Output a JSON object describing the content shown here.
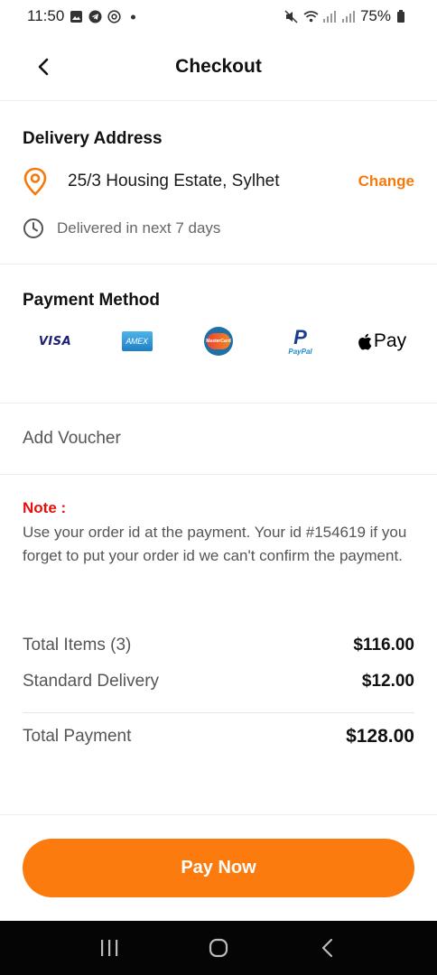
{
  "status_bar": {
    "time": "11:50",
    "battery": "75%",
    "left_icons": [
      "gallery-icon",
      "telegram-icon",
      "at-icon",
      "dot-icon"
    ],
    "right_icons": [
      "mute-icon",
      "wifi-icon",
      "signal-icon",
      "signal-icon",
      "battery-icon"
    ]
  },
  "header": {
    "title": "Checkout",
    "back_icon": "chevron-left-icon"
  },
  "delivery": {
    "title": "Delivery Address",
    "address": "25/3 Housing Estate, Sylhet",
    "change_label": "Change",
    "eta": "Delivered in next 7 days",
    "accent_color": "#f57a0c"
  },
  "payment": {
    "title": "Payment Method",
    "methods": [
      {
        "name": "visa",
        "label": "VISA"
      },
      {
        "name": "amex",
        "label": "AMEX"
      },
      {
        "name": "mastercard",
        "label": "MasterCard"
      },
      {
        "name": "paypal",
        "label": "PayPal"
      },
      {
        "name": "apple-pay",
        "label": "Pay"
      }
    ]
  },
  "voucher": {
    "label": "Add Voucher"
  },
  "note": {
    "label": "Note :",
    "text": "Use your order id at the payment. Your id #154619 if you forget to put your order id we can't confirm the payment.",
    "label_color": "#e8100c"
  },
  "summary": {
    "items_label": "Total Items (3)",
    "items_value": "$116.00",
    "delivery_label": "Standard Delivery",
    "delivery_value": "$12.00",
    "total_label": "Total Payment",
    "total_value": "$128.00"
  },
  "pay_button": {
    "label": "Pay Now",
    "color": "#fb7b0f"
  },
  "nav_bar": {
    "buttons": [
      "recent-apps-icon",
      "home-icon",
      "back-icon"
    ]
  }
}
